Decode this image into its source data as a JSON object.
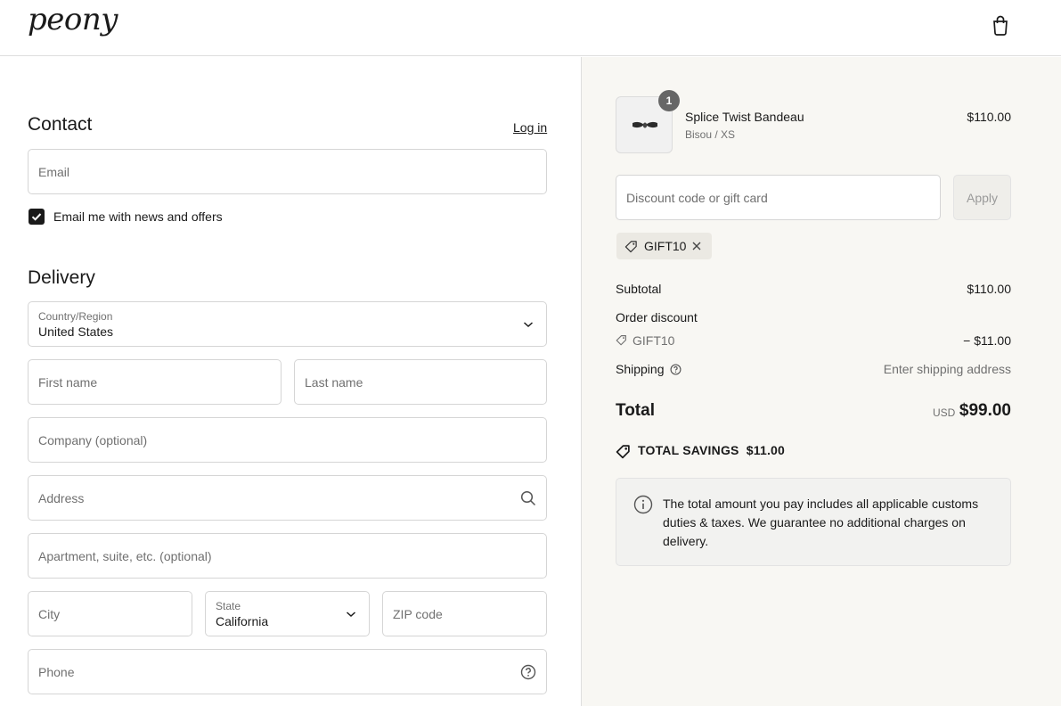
{
  "header": {
    "logo": "peony",
    "bag_icon": "shopping-bag-icon"
  },
  "contact": {
    "title": "Contact",
    "login_link": "Log in",
    "email_placeholder": "Email",
    "newsletter_label": "Email me with news and offers",
    "newsletter_checked": true
  },
  "delivery": {
    "title": "Delivery",
    "country_label": "Country/Region",
    "country_value": "United States",
    "first_name_placeholder": "First name",
    "last_name_placeholder": "Last name",
    "company_placeholder": "Company (optional)",
    "address_placeholder": "Address",
    "apartment_placeholder": "Apartment, suite, etc. (optional)",
    "city_placeholder": "City",
    "state_label": "State",
    "state_value": "California",
    "zip_placeholder": "ZIP code",
    "phone_placeholder": "Phone"
  },
  "order": {
    "item": {
      "quantity": "1",
      "name": "Splice Twist Bandeau",
      "variant": "Bisou / XS",
      "price": "$110.00"
    },
    "discount_placeholder": "Discount code or gift card",
    "apply_label": "Apply",
    "applied_code": "GIFT10",
    "subtotal_label": "Subtotal",
    "subtotal_value": "$110.00",
    "order_discount_label": "Order discount",
    "discount_code": "GIFT10",
    "discount_value": "− $11.00",
    "shipping_label": "Shipping",
    "shipping_value": "Enter shipping address",
    "total_label": "Total",
    "currency": "USD",
    "total_value": "$99.00",
    "savings_text": "TOTAL SAVINGS  $11.00",
    "notice_text": "The total amount you pay includes all applicable customs duties & taxes. We guarantee no additional charges on delivery."
  },
  "colors": {
    "accent": "#1a1a1a",
    "sidebar_bg": "#f8f7f3",
    "muted": "#707070"
  }
}
